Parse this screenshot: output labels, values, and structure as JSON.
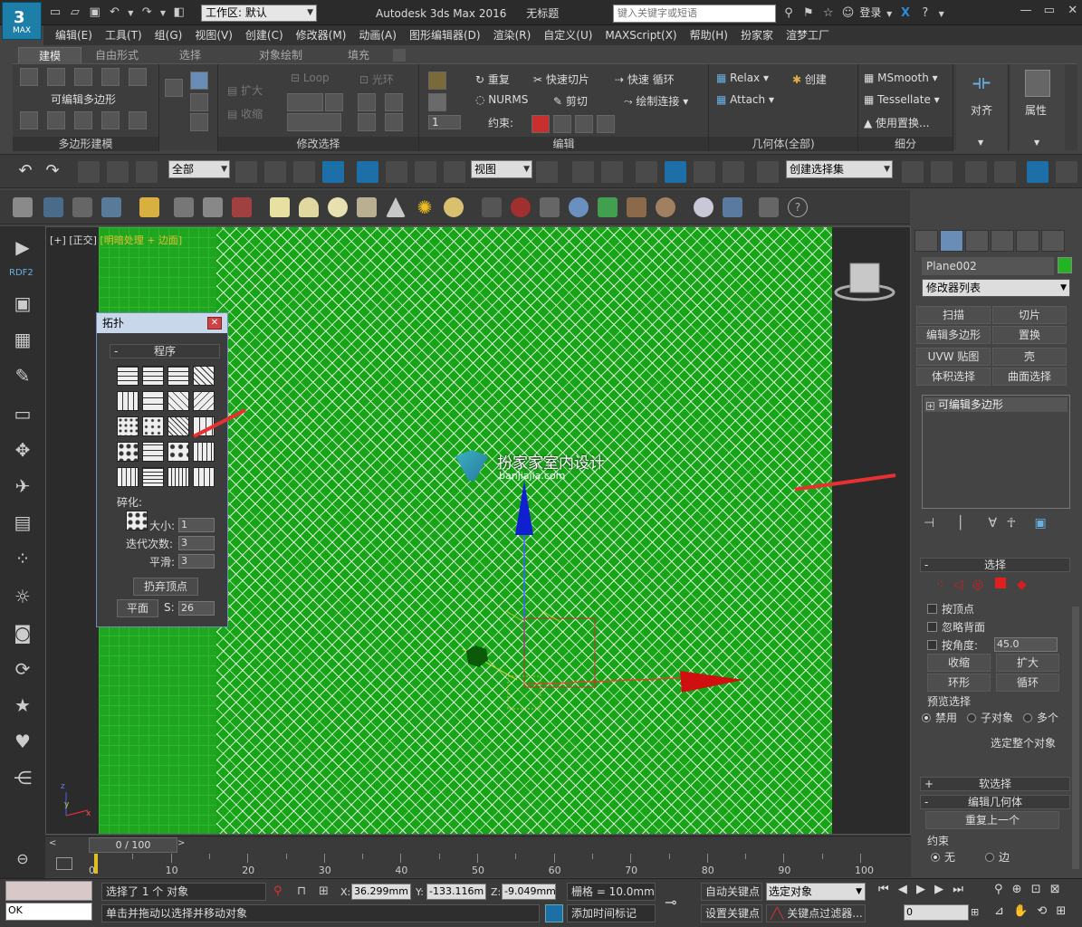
{
  "title": {
    "app": "Autodesk 3ds Max 2016",
    "doc": "无标题",
    "workspace_label": "工作区: 默认",
    "search_placeholder": "键入关键字或短语",
    "login": "登录",
    "logo": "MAX"
  },
  "menu": [
    "编辑(E)",
    "工具(T)",
    "组(G)",
    "视图(V)",
    "创建(C)",
    "修改器(M)",
    "动画(A)",
    "图形编辑器(D)",
    "渲染(R)",
    "自定义(U)",
    "MAXScript(X)",
    "帮助(H)",
    "扮家家",
    "渲梦工厂"
  ],
  "ribbon_tabs": [
    "建模",
    "自由形式",
    "选择",
    "对象绘制",
    "填充"
  ],
  "ribbon": {
    "poly_modeling_label": "可编辑多边形",
    "group_poly": "多边形建模",
    "group_modsel": "修改选择",
    "group_edit": "编辑",
    "group_geometry": "几何体(全部)",
    "group_subdiv": "细分",
    "expand": "扩大",
    "shrink": "收缩",
    "loop": "Loop",
    "ring": "光环",
    "repeat": "重复",
    "quickslice": "快速切片",
    "quickloop": "快速 循环",
    "nurms": "NURMS",
    "cut": "剪切",
    "drawconnect": "绘制连接",
    "constraint": "约束:",
    "spinner_val": "1",
    "relax": "Relax",
    "create": "创建",
    "attach": "Attach",
    "msmooth": "MSmooth",
    "tessellate": "Tessellate",
    "displace": "使用置换...",
    "align": "对齐",
    "props": "属性"
  },
  "maintool": {
    "filter": "全部",
    "refcoord": "视图",
    "selset": "创建选择集"
  },
  "viewport": {
    "label_a": "[+]",
    "label_b": "[正交]",
    "label_c": "[明暗处理 + 边面]",
    "watermark": "扮家家室内设计",
    "watermark_url": "banjiajia.com"
  },
  "topology": {
    "title": "拓扑",
    "rollout": "程序",
    "fragment": "碎化:",
    "size_label": "大小:",
    "size_val": "1",
    "iter_label": "迭代次数:",
    "iter_val": "3",
    "smooth_label": "平滑:",
    "smooth_val": "3",
    "discard": "扔弃顶点",
    "plane": "平面",
    "s_label": "S:",
    "s_val": "26"
  },
  "cmdpanel": {
    "object_name": "Plane002",
    "object_color": "#22b522",
    "modifier_list": "修改器列表",
    "buttons": [
      "扫描",
      "切片",
      "编辑多边形",
      "置换",
      "UVW 贴图",
      "壳",
      "体积选择",
      "曲面选择"
    ],
    "stack_item": "可编辑多边形",
    "sel_rollout": "选择",
    "by_vertex": "按顶点",
    "ignore_back": "忽略背面",
    "by_angle": "按角度:",
    "angle_val": "45.0",
    "shrink": "收缩",
    "grow": "扩大",
    "ring": "环形",
    "loop": "循环",
    "preview": "预览选择",
    "disable": "禁用",
    "subobj": "子对象",
    "multi": "多个",
    "select_whole": "选定整个对象",
    "soft_sel": "软选择",
    "edit_geo": "编辑几何体",
    "repeat_last": "重复上一个",
    "constraints": "约束",
    "none": "无",
    "edge": "边"
  },
  "timeline": {
    "frame": "0 / 100",
    "ticks": [
      0,
      10,
      20,
      30,
      40,
      50,
      60,
      70,
      80,
      90,
      100
    ]
  },
  "status": {
    "selected": "选择了 1 个 对象",
    "hint": "单击并拖动以选择并移动对象",
    "ok": "OK",
    "x_label": "X:",
    "x": "36.299mm",
    "y_label": "Y:",
    "y": "-133.116m",
    "z_label": "Z:",
    "z": "-9.049mm",
    "grid": "栅格 = 10.0mm",
    "add_time_tag": "添加时间标记",
    "auto_key": "自动关键点",
    "selected_obj": "选定对象",
    "set_key": "设置关键点",
    "key_filter": "关键点过滤器...",
    "frame_val": "0"
  }
}
